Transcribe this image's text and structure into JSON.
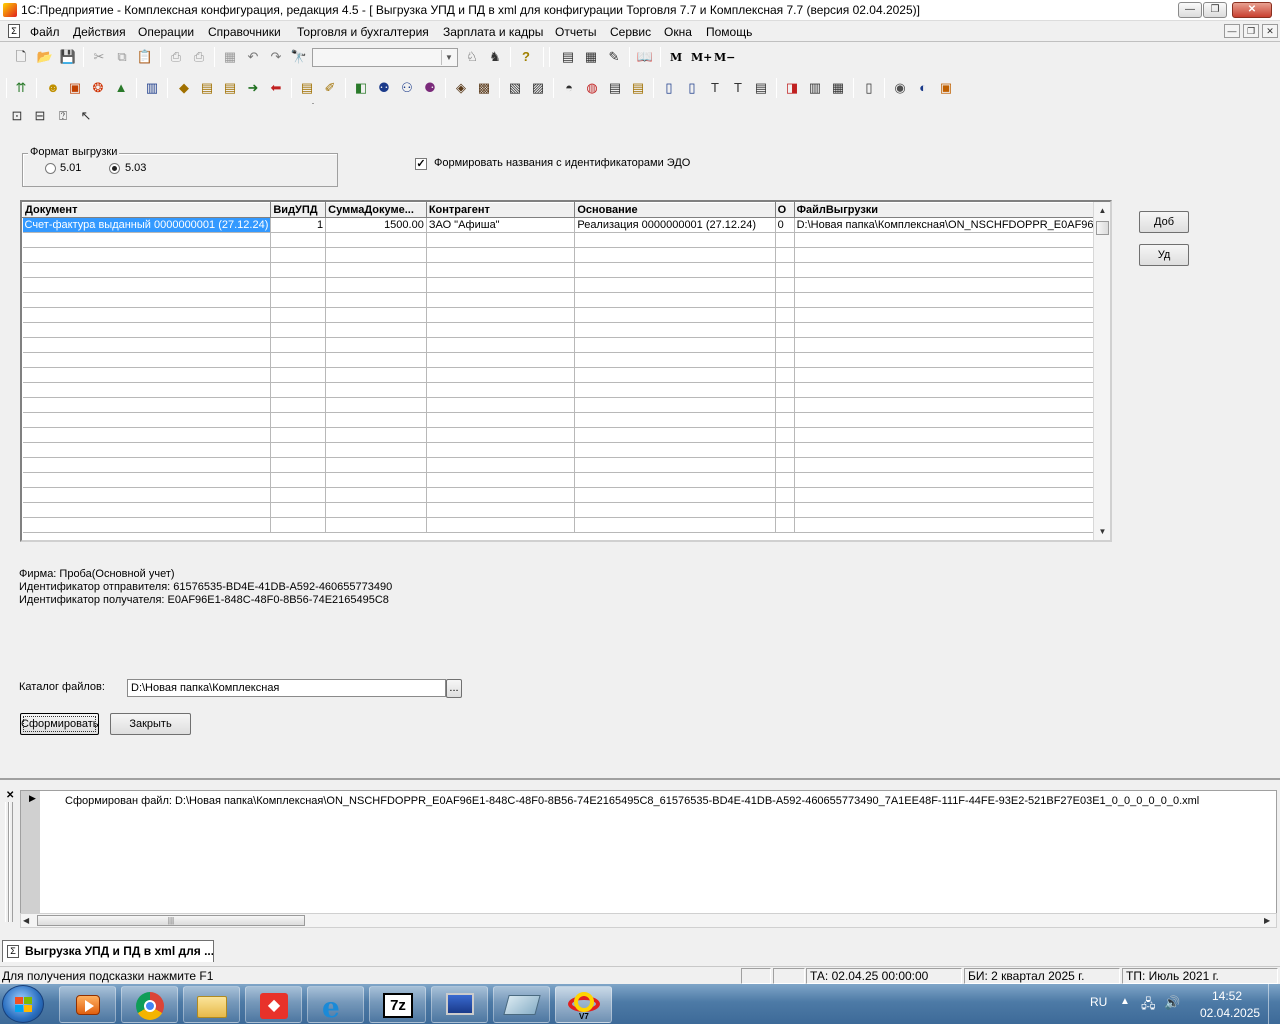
{
  "window": {
    "title": "1С:Предприятие - Комплексная конфигурация, редакция 4.5 - [ Выгрузка УПД и ПД в xml для конфигурации Торговля 7.7 и Комплексная 7.7 (версия 02.04.2025)]",
    "minimize": "—",
    "maximize": "❐",
    "close": "✕"
  },
  "menu": {
    "items": [
      "Файл",
      "Действия",
      "Операции",
      "Справочники",
      "Торговля и бухгалтерия",
      "Зарплата и кадры",
      "Отчеты",
      "Сервис",
      "Окна",
      "Помощь"
    ],
    "mdi_minimize": "—",
    "mdi_restore": "❐",
    "mdi_close": "✕"
  },
  "toolbar": {
    "memory_labels": [
      "M",
      "M+",
      "M−"
    ],
    "combo_value": ""
  },
  "form": {
    "format_group": {
      "title": "Формат выгрузки",
      "options": [
        "5.01",
        "5.03"
      ],
      "selected": "5.03"
    },
    "edo_checkbox": {
      "label": "Формировать названия с идентификаторами ЭДО",
      "checked": true,
      "mark": "✓"
    },
    "grid": {
      "columns": [
        "Документ",
        "ВидУПД",
        "СуммаДокуме...",
        "Контрагент",
        "Основание",
        "О",
        "ФайлВыгрузки"
      ],
      "rows": [
        [
          "Счет-фактура выданный 0000000001 (27.12.24)",
          "1",
          "1500.00",
          "ЗАО \"Афиша\"",
          "Реализация  0000000001 (27.12.24)",
          "0",
          "D:\\Новая папка\\Комплексная\\ON_NSCHFDOPPR_E0AF96E1"
        ]
      ],
      "empty_rows": 20
    },
    "buttons": {
      "add": "Доб",
      "delete": "Уд",
      "generate": "Сформировать",
      "close": "Закрыть",
      "browse": "..."
    },
    "info": {
      "firm": "Фирма: Проба(Основной учет)",
      "sender_id": "Идентификатор отправителя: 61576535-BD4E-41DB-A592-460655773490",
      "receiver_id": "Идентификатор получателя: E0AF96E1-848C-48F0-8B56-74E2165495C8"
    },
    "catalog": {
      "label": "Каталог файлов:",
      "value": "D:\\Новая папка\\Комплексная"
    }
  },
  "messages": {
    "lines": [
      "Сформирован файл: D:\\Новая папка\\Комплексная\\ON_NSCHFDOPPR_E0AF96E1-848C-48F0-8B56-74E2165495C8_61576535-BD4E-41DB-A592-460655773490_7A1EE48F-111F-44FE-93E2-521BF27E03E1_0_0_0_0_0_0.xml"
    ]
  },
  "doc_tab": {
    "label": "Выгрузка УПД и ПД в xml для ..."
  },
  "statusbar": {
    "hint": "Для получения подсказки нажмите F1",
    "ta": "ТА: 02.04.25  00:00:00",
    "bi": "БИ: 2 квартал 2025 г.",
    "tp": "ТП: Июль 2021 г."
  },
  "taskbar": {
    "lang": "RU",
    "time": "14:52",
    "date": "02.04.2025",
    "seven_zip": "7z",
    "one_c_v7": "V7"
  }
}
